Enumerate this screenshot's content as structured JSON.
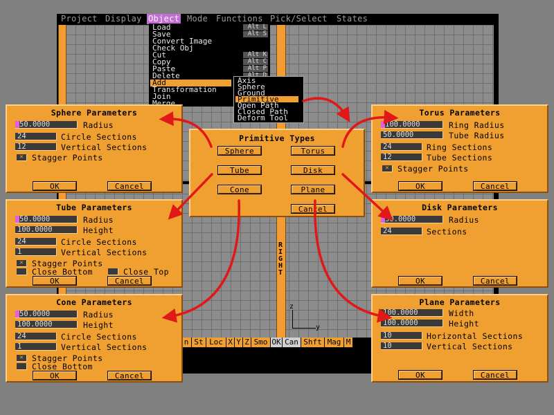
{
  "menubar": {
    "items": [
      "Project",
      "Display",
      "Object",
      "Mode",
      "Functions",
      "Pick/Select",
      "States"
    ]
  },
  "object_menu": {
    "items": [
      {
        "label": "Load",
        "shortcut": "Alt L"
      },
      {
        "label": "Save",
        "shortcut": "Alt S"
      },
      {
        "label": "Convert Image",
        "shortcut": ""
      },
      {
        "label": "Check Obj",
        "shortcut": ""
      },
      {
        "label": "Cut",
        "shortcut": "Alt K"
      },
      {
        "label": "Copy",
        "shortcut": "Alt C"
      },
      {
        "label": "Paste",
        "shortcut": "Alt P"
      },
      {
        "label": "Delete",
        "shortcut": "Alt D"
      },
      {
        "label": "Add",
        "shortcut": ""
      },
      {
        "label": "Transformation",
        "shortcut": ""
      },
      {
        "label": "Join",
        "shortcut": ""
      },
      {
        "label": "Merge",
        "shortcut": ""
      }
    ]
  },
  "add_submenu": {
    "items": [
      "Axis",
      "Sphere",
      "Ground",
      "Primitive",
      "Open Path",
      "Closed Path",
      "Deform Tool"
    ]
  },
  "viewport_labels": {
    "right": "RIGHT",
    "z_axis": "z",
    "y_axis": "y"
  },
  "bottom_bar": {
    "items": [
      "n",
      "St",
      "Loc",
      "X",
      "Y",
      "Z",
      "Smo",
      "OK",
      "Can",
      "Shft",
      "Mag",
      "M"
    ]
  },
  "primitive_types": {
    "title": "Primitive Types",
    "sphere": "Sphere",
    "torus": "Torus",
    "tube": "Tube",
    "disk": "Disk",
    "cone": "Cone",
    "plane": "Plane",
    "cancel": "Cancel"
  },
  "sphere": {
    "title": "Sphere Parameters",
    "radius_value": "50.0000",
    "radius_label": "Radius",
    "circle_value": "24",
    "circle_label": "Circle Sections",
    "vertical_value": "12",
    "vertical_label": "Vertical Sections",
    "stagger_label": "Stagger Points",
    "ok": "OK",
    "cancel": "Cancel"
  },
  "tube": {
    "title": "Tube Parameters",
    "radius_value": "50.0000",
    "radius_label": "Radius",
    "height_value": "100.0000",
    "height_label": "Height",
    "circle_value": "24",
    "circle_label": "Circle Sections",
    "vertical_value": "1",
    "vertical_label": "Vertical Sections",
    "stagger_label": "Stagger Points",
    "close_bottom_label": "Close Bottom",
    "close_top_label": "Close Top",
    "ok": "OK",
    "cancel": "Cancel"
  },
  "cone": {
    "title": "Cone Parameters",
    "radius_value": "50.0000",
    "radius_label": "Radius",
    "height_value": "100.0000",
    "height_label": "Height",
    "circle_value": "24",
    "circle_label": "Circle Sections",
    "vertical_value": "1",
    "vertical_label": "Vertical Sections",
    "stagger_label": "Stagger Points",
    "close_bottom_label": "Close Bottom",
    "ok": "OK",
    "cancel": "Cancel"
  },
  "torus": {
    "title": "Torus Parameters",
    "ring_radius_value": "100.0000",
    "ring_radius_label": "Ring Radius",
    "tube_radius_value": "50.0000",
    "tube_radius_label": "Tube Radius",
    "ring_sections_value": "24",
    "ring_sections_label": "Ring Sections",
    "tube_sections_value": "12",
    "tube_sections_label": "Tube Sections",
    "stagger_label": "Stagger Points",
    "ok": "OK",
    "cancel": "Cancel"
  },
  "disk": {
    "title": "Disk Parameters",
    "radius_value": "50.0000",
    "radius_label": "Radius",
    "sections_value": "24",
    "sections_label": "Sections",
    "ok": "OK",
    "cancel": "Cancel"
  },
  "plane": {
    "title": "Plane Parameters",
    "width_value": "100.0000",
    "width_label": "Width",
    "height_value": "100.0000",
    "height_label": "Height",
    "horizontal_value": "10",
    "horizontal_label": "Horizontal Sections",
    "vertical_value": "10",
    "vertical_label": "Vertical Sections",
    "ok": "OK",
    "cancel": "Cancel"
  },
  "colors": {
    "panel": "#f0a030",
    "arrow": "#e01818",
    "highlight": "#c070d0",
    "field": "#3a3a3a"
  }
}
